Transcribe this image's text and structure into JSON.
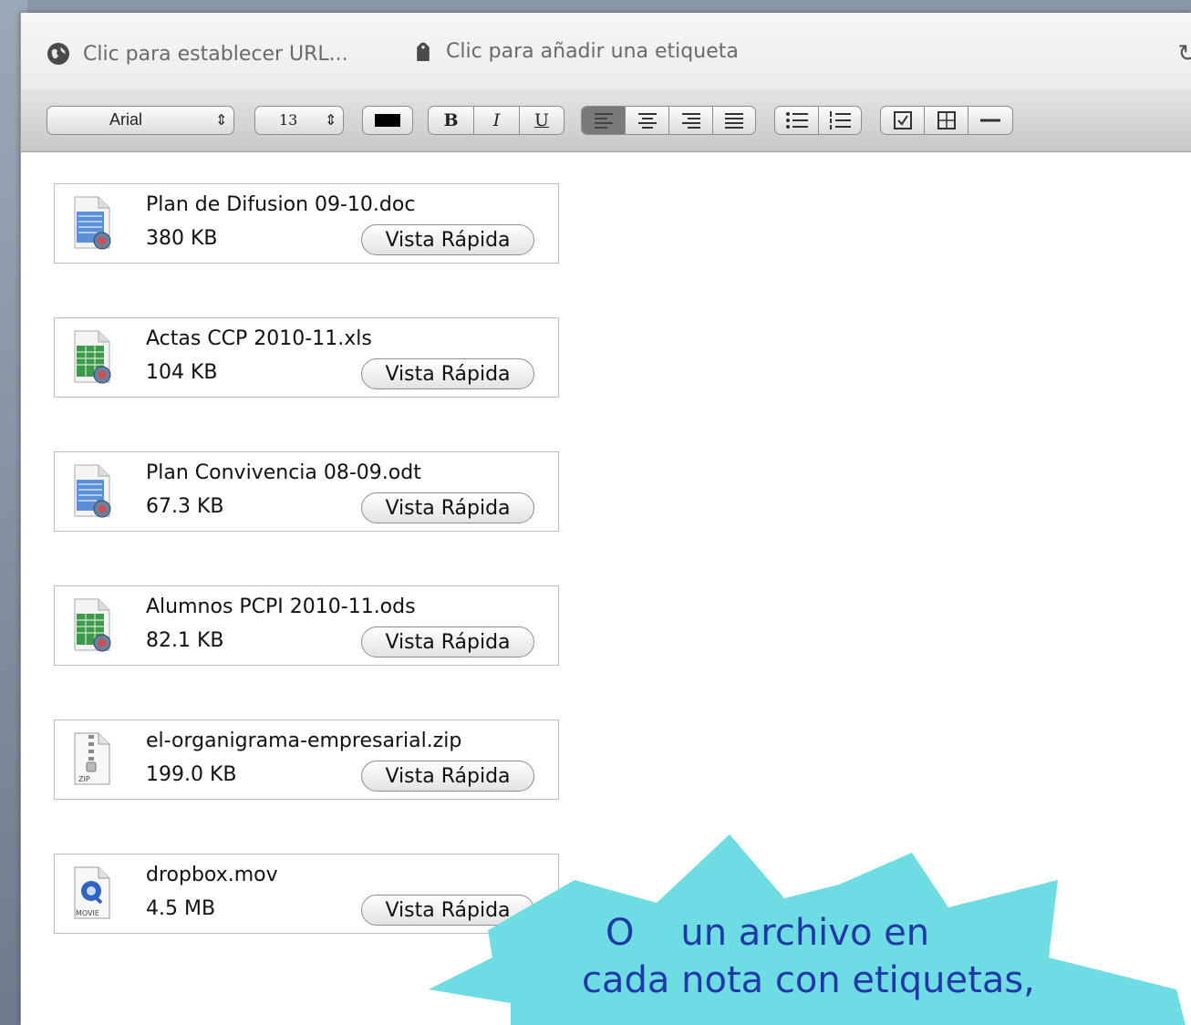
{
  "urlbar": {
    "url_label": "Clic para establecer URL...",
    "tag_label": "Clic para añadir una etiqueta",
    "refresh_icon": "refresh-icon"
  },
  "toolbar": {
    "font": "Arial",
    "size": "13",
    "bold": "B",
    "italic": "I",
    "underline": "U"
  },
  "attachments": [
    {
      "name": "Plan de Difusion 09-10.doc",
      "size": "380 KB",
      "type": "doc",
      "button": "Vista Rápida"
    },
    {
      "name": "Actas CCP 2010-11.xls",
      "size": "104 KB",
      "type": "xls",
      "button": "Vista Rápida"
    },
    {
      "name": "Plan Convivencia 08-09.odt",
      "size": "67.3 KB",
      "type": "doc",
      "button": "Vista Rápida"
    },
    {
      "name": "Alumnos PCPI 2010-11.ods",
      "size": "82.1 KB",
      "type": "xls",
      "button": "Vista Rápida"
    },
    {
      "name": "el-organigrama-empresarial.zip",
      "size": "199.0 KB",
      "type": "zip",
      "button": "Vista Rápida"
    },
    {
      "name": "dropbox.mov",
      "size": "4.5 MB",
      "type": "mov",
      "button": "Vista Rápida"
    }
  ],
  "callout": {
    "line1": "O    un archivo en",
    "line2": "cada nota con etiquetas,",
    "color": "#6ddde3"
  }
}
